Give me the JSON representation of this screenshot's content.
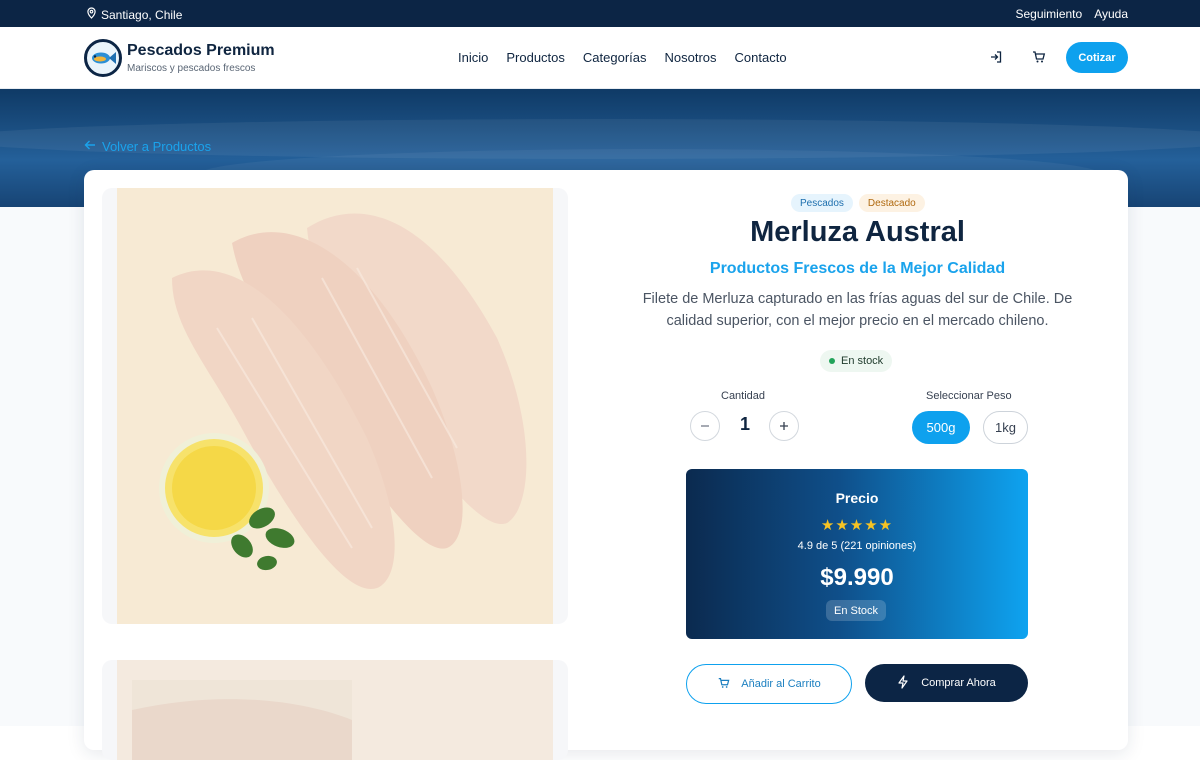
{
  "topbar": {
    "location": "Santiago, Chile",
    "tracking": "Seguimiento",
    "help": "Ayuda"
  },
  "header": {
    "brand_title": "Pescados Premium",
    "brand_subtitle": "Mariscos y pescados frescos",
    "nav": [
      "Inicio",
      "Productos",
      "Categorías",
      "Nosotros",
      "Contacto"
    ],
    "cta": "Cotizar",
    "icons": [
      "login-icon",
      "cart-icon"
    ]
  },
  "back_link": "Volver a Productos",
  "product": {
    "tags": [
      "Pescados",
      "Destacado"
    ],
    "name": "Merluza Austral",
    "subtitle": "Productos Frescos de la Mejor Calidad",
    "description": "Filete de Merluza capturado en las frías aguas del sur de Chile. De calidad superior, con el mejor precio en el mercado chileno.",
    "stock_badge": "En stock",
    "quantity_label": "Cantidad",
    "quantity": "1",
    "weight_label": "Seleccionar Peso",
    "weights": [
      "500g",
      "1kg"
    ],
    "selected_weight": "500g"
  },
  "price_box": {
    "label": "Precio",
    "stars": "★★★★★",
    "rating_value": 4.9,
    "rating_text": "4.9 de 5 (221 opiniones)",
    "amount": "$9.990",
    "stock": "En Stock"
  },
  "actions": {
    "add_to_cart": "Añadir al Carrito",
    "buy_now": "Comprar Ahora"
  },
  "colors": {
    "navy": "#0c2545",
    "accent": "#0ea1ee",
    "star": "#f6c324"
  }
}
